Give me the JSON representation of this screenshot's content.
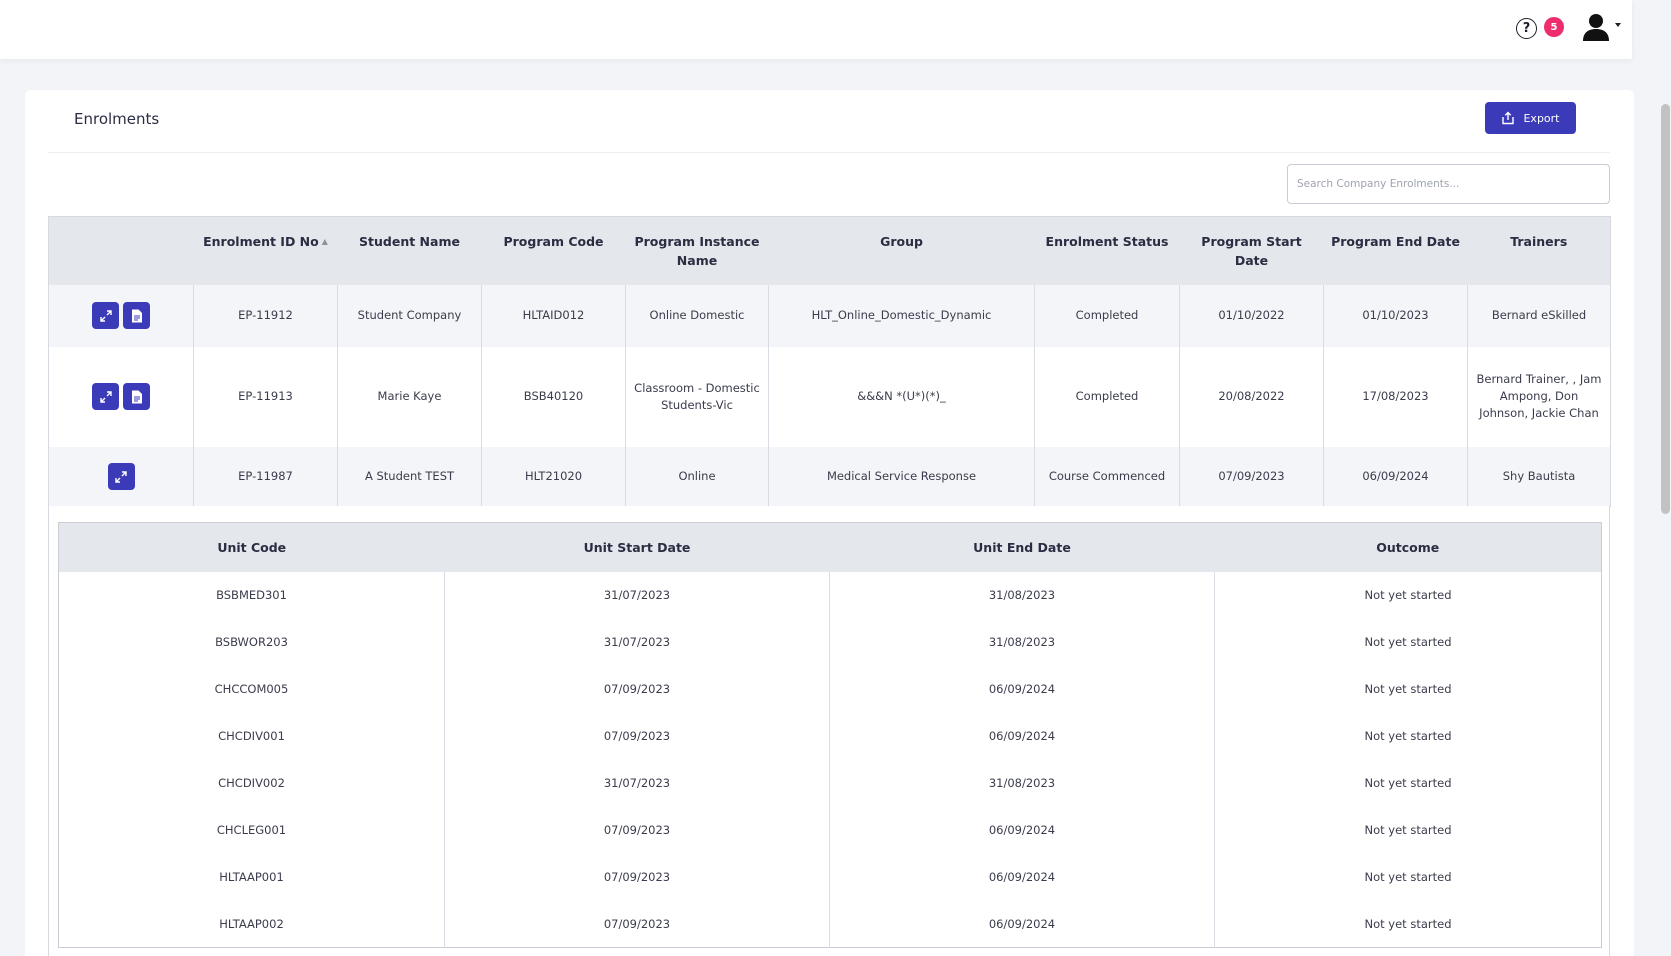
{
  "topbar": {
    "help_icon": "?",
    "notification_count": "5"
  },
  "page": {
    "title": "Enrolments",
    "export_label": "Export",
    "search_placeholder": "Search Company Enrolments..."
  },
  "main_table": {
    "headers": {
      "actions": "",
      "enrolment_id": "Enrolment ID No",
      "student_name": "Student Name",
      "program_code": "Program Code",
      "program_instance": "Program Instance Name",
      "group": "Group",
      "status": "Enrolment Status",
      "start_date": "Program Start Date",
      "end_date": "Program End Date",
      "trainers": "Trainers"
    },
    "rows": [
      {
        "enrolment_id": "EP-11912",
        "student_name": "Student Company",
        "program_code": "HLTAID012",
        "program_instance": "Online Domestic",
        "group": "HLT_Online_Domestic_Dynamic",
        "status": "Completed",
        "start_date": "01/10/2022",
        "end_date": "01/10/2023",
        "trainers": "Bernard eSkilled"
      },
      {
        "enrolment_id": "EP-11913",
        "student_name": "Marie Kaye",
        "program_code": "BSB40120",
        "program_instance": "Classroom - Domestic Students-Vic",
        "group": "&&&N *(U*)(*)_",
        "status": "Completed",
        "start_date": "20/08/2022",
        "end_date": "17/08/2023",
        "trainers": "Bernard Trainer, , Jam Ampong, Don Johnson, Jackie Chan"
      },
      {
        "enrolment_id": "EP-11987",
        "student_name": "A Student TEST",
        "program_code": "HLT21020",
        "program_instance": "Online",
        "group": "Medical Service Response",
        "status": "Course Commenced",
        "start_date": "07/09/2023",
        "end_date": "06/09/2024",
        "trainers": "Shy Bautista"
      }
    ]
  },
  "unit_table": {
    "headers": {
      "unit_code": "Unit Code",
      "start": "Unit Start Date",
      "end": "Unit End Date",
      "outcome": "Outcome"
    },
    "rows": [
      {
        "unit_code": "BSBMED301",
        "start": "31/07/2023",
        "end": "31/08/2023",
        "outcome": "Not yet started"
      },
      {
        "unit_code": "BSBWOR203",
        "start": "31/07/2023",
        "end": "31/08/2023",
        "outcome": "Not yet started"
      },
      {
        "unit_code": "CHCCOM005",
        "start": "07/09/2023",
        "end": "06/09/2024",
        "outcome": "Not yet started"
      },
      {
        "unit_code": "CHCDIV001",
        "start": "07/09/2023",
        "end": "06/09/2024",
        "outcome": "Not yet started"
      },
      {
        "unit_code": "CHCDIV002",
        "start": "31/07/2023",
        "end": "31/08/2023",
        "outcome": "Not yet started"
      },
      {
        "unit_code": "CHCLEG001",
        "start": "07/09/2023",
        "end": "06/09/2024",
        "outcome": "Not yet started"
      },
      {
        "unit_code": "HLTAAP001",
        "start": "07/09/2023",
        "end": "06/09/2024",
        "outcome": "Not yet started"
      },
      {
        "unit_code": "HLTAAP002",
        "start": "07/09/2023",
        "end": "06/09/2024",
        "outcome": "Not yet started"
      }
    ]
  },
  "colors": {
    "accent": "#3b3ab8",
    "badge": "#ec2d6e",
    "header_bg": "#e4e7ec"
  },
  "icons": {
    "help": "help-circle-icon",
    "avatar": "user-icon",
    "export": "upload-icon",
    "expand": "expand-icon",
    "document": "document-icon"
  }
}
